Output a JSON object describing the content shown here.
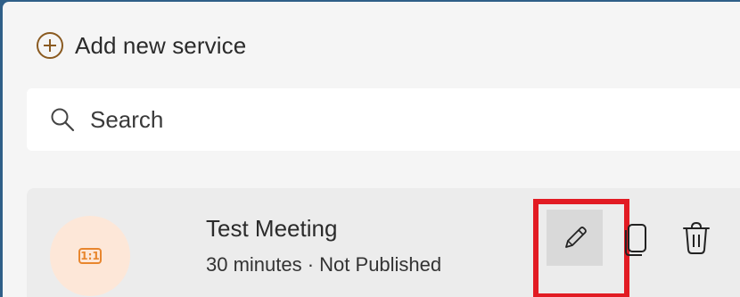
{
  "toolbar": {
    "add_service_label": "Add new service",
    "add_icon": "plus-circle-icon"
  },
  "search": {
    "placeholder": "Search",
    "value": "",
    "icon": "search-icon"
  },
  "services": [
    {
      "title": "Test Meeting",
      "duration": "30 minutes",
      "separator": "·",
      "status": "Not Published",
      "meta": "30 minutes · Not Published",
      "avatar_icon": "one-on-one-icon",
      "avatar_text": "1:1",
      "actions": {
        "edit_icon": "pencil-icon",
        "copy_icon": "copy-icon",
        "delete_icon": "trash-icon"
      }
    }
  ],
  "colors": {
    "accent": "#c07a2a",
    "avatar_bg": "#fde7d8",
    "avatar_fg": "#e8862e",
    "highlight": "#e21b23",
    "frame": "#2f5f88"
  }
}
